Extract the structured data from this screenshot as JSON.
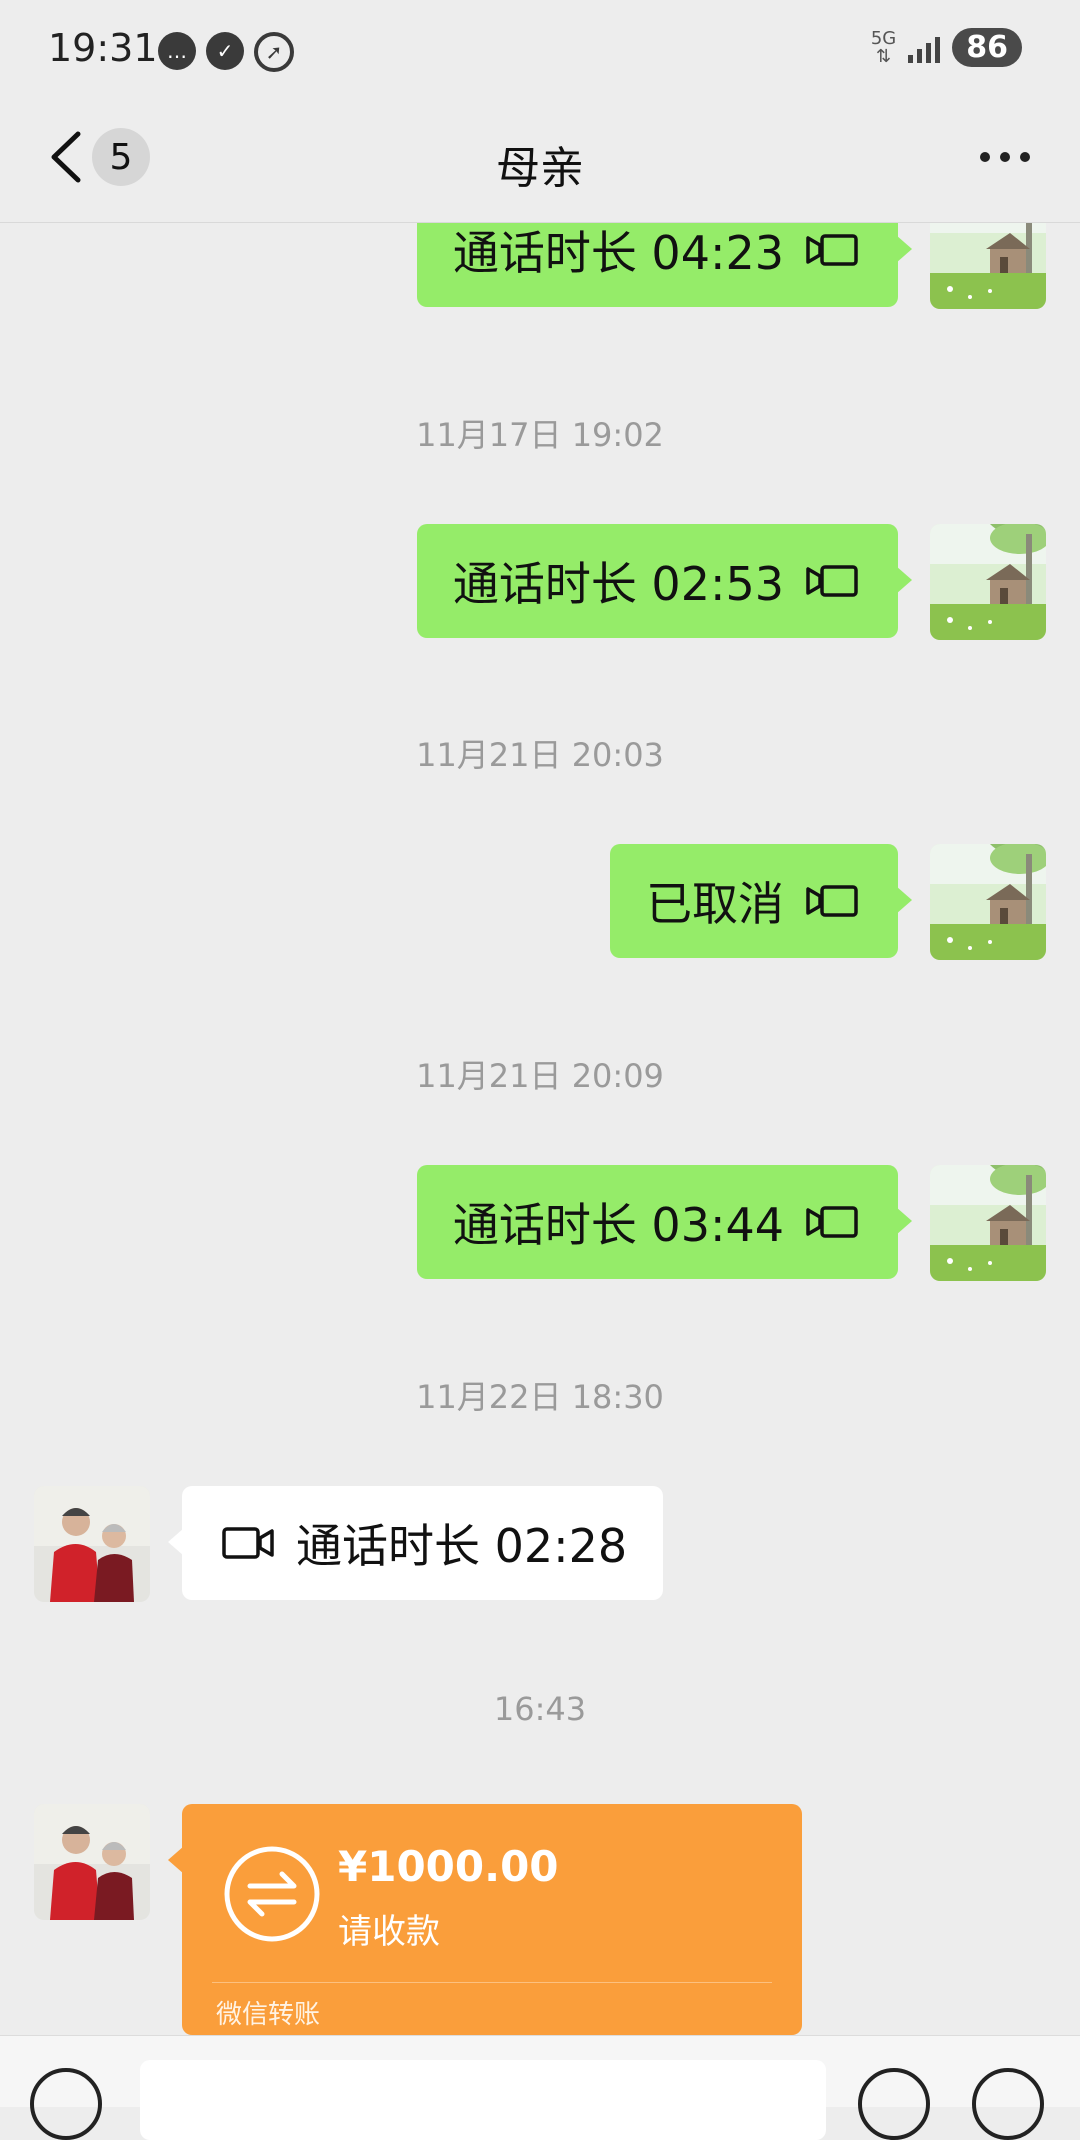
{
  "status_bar": {
    "time": "19:31",
    "network": "5G",
    "battery": "86",
    "icons": [
      "message-icon",
      "check-icon",
      "rocket-icon",
      "signal-icon"
    ]
  },
  "nav": {
    "title": "母亲",
    "unread_count": "5",
    "icons": [
      "back-icon",
      "more-icon"
    ]
  },
  "messages": [
    {
      "type": "call",
      "direction": "out",
      "text": "通话时长 04:23"
    },
    {
      "type": "timestamp",
      "text": "11月17日 19:02"
    },
    {
      "type": "call",
      "direction": "out",
      "text": "通话时长 02:53"
    },
    {
      "type": "timestamp",
      "text": "11月21日 20:03"
    },
    {
      "type": "call",
      "direction": "out",
      "text": "已取消"
    },
    {
      "type": "timestamp",
      "text": "11月21日 20:09"
    },
    {
      "type": "call",
      "direction": "out",
      "text": "通话时长 03:44"
    },
    {
      "type": "timestamp",
      "text": "11月22日 18:30"
    },
    {
      "type": "call",
      "direction": "in",
      "text": "通话时长 02:28"
    },
    {
      "type": "timestamp",
      "text": "16:43"
    },
    {
      "type": "transfer",
      "direction": "in",
      "amount": "¥1000.00",
      "status": "请收款",
      "label": "微信转账"
    }
  ],
  "colors": {
    "background": "#ededed",
    "outgoing_bubble": "#95ec69",
    "incoming_bubble": "#ffffff",
    "transfer_card": "#fa9e3b",
    "timestamp_text": "#9a9a9a"
  },
  "input_bar": {
    "icons": [
      "voice-icon",
      "emoji-icon",
      "plus-icon"
    ]
  }
}
